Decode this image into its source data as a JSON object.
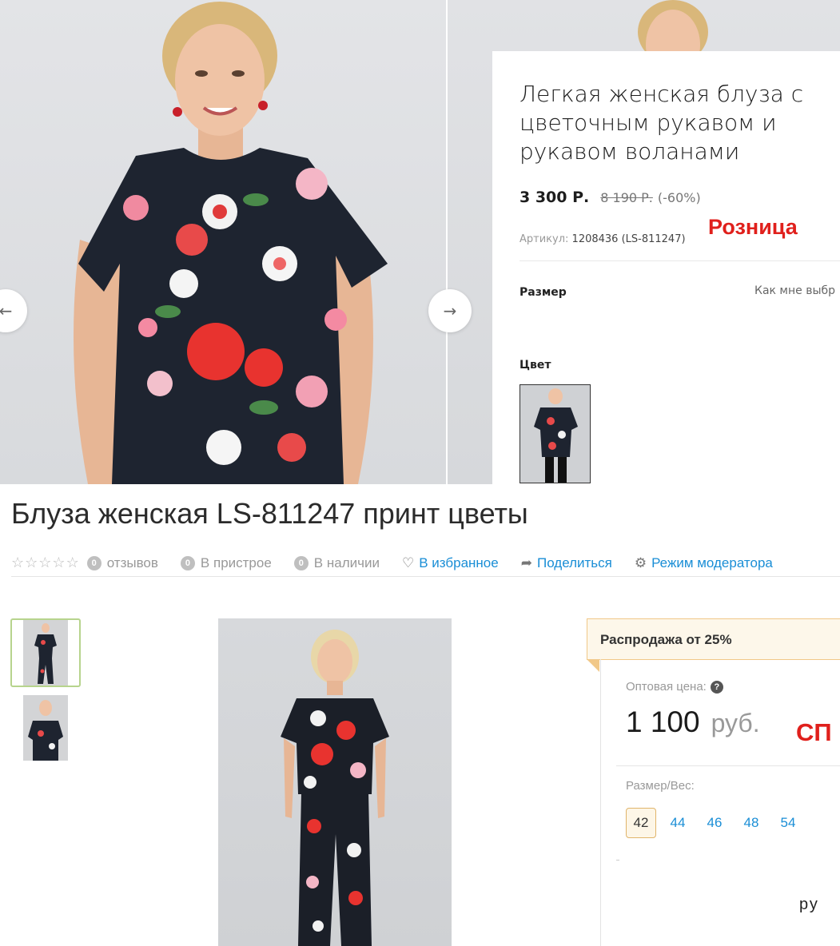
{
  "retail": {
    "product_title": "Легкая женская блуза с цветочным рукавом и рукавом воланами",
    "price_current": "3 300 Р.",
    "price_old": "8 190 Р.",
    "discount": "(-60%)",
    "article_label": "Артикул:",
    "article_value": "1208436 (LS-811247)",
    "tag": "Розница",
    "size_label": "Размер",
    "size_help": "Как мне выбр",
    "color_label": "Цвет",
    "arrow_left": "←",
    "arrow_right": "→"
  },
  "wholesale": {
    "product_title": "Блуза женская LS-811247 принт цветы",
    "reviews_count": "0",
    "reviews_label": "отзывов",
    "attach_count": "0",
    "attach_label": "В пристрое",
    "stock_count": "0",
    "stock_label": "В наличии",
    "favorite_label": "В избранное",
    "share_label": "Поделиться",
    "moderator_label": "Режим модератора",
    "sale_banner": "Распродажа от 25%",
    "price_label": "Оптовая цена:",
    "price_value": "1 100",
    "price_currency": "руб.",
    "tag": "СП",
    "size_label": "Размер/Вес:",
    "sizes": [
      "42",
      "44",
      "46",
      "48",
      "54"
    ],
    "selected_size": "42",
    "cut_text": "ру"
  },
  "colors": {
    "accent_link": "#1a8ed6",
    "tag_red": "#e0201c",
    "sale_border": "#f1c888",
    "thumb_active_border": "#b7d48d"
  }
}
